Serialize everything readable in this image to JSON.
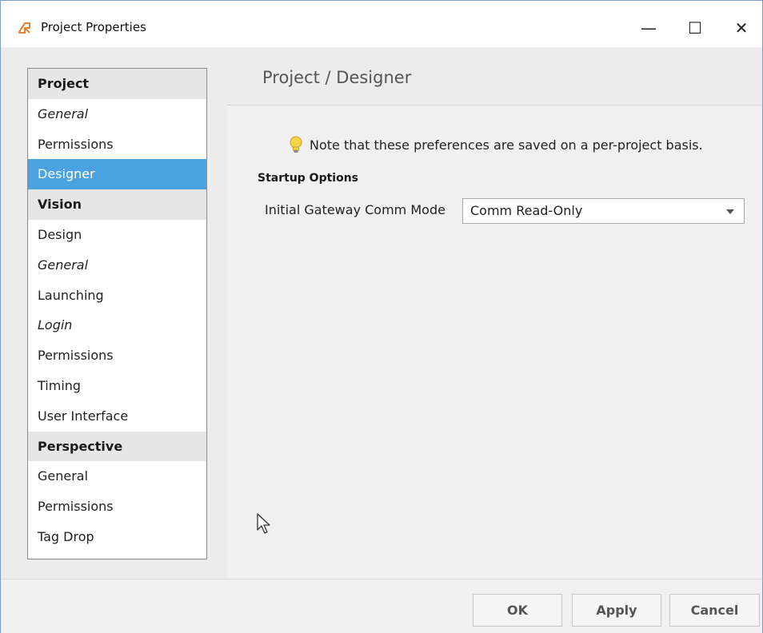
{
  "window": {
    "title": "Project Properties",
    "minimize_glyph": "—",
    "maximize_glyph": "☐",
    "close_glyph": "✕"
  },
  "sidebar": {
    "items": [
      {
        "label": "Project",
        "kind": "header"
      },
      {
        "label": "General",
        "kind": "item",
        "italic": true
      },
      {
        "label": "Permissions",
        "kind": "item"
      },
      {
        "label": "Designer",
        "kind": "item",
        "selected": true
      },
      {
        "label": "Vision",
        "kind": "header"
      },
      {
        "label": "Design",
        "kind": "item"
      },
      {
        "label": "General",
        "kind": "item",
        "italic": true
      },
      {
        "label": "Launching",
        "kind": "item"
      },
      {
        "label": "Login",
        "kind": "item",
        "italic": true
      },
      {
        "label": "Permissions",
        "kind": "item"
      },
      {
        "label": "Timing",
        "kind": "item"
      },
      {
        "label": "User Interface",
        "kind": "item"
      },
      {
        "label": "Perspective",
        "kind": "header"
      },
      {
        "label": "General",
        "kind": "item"
      },
      {
        "label": "Permissions",
        "kind": "item"
      },
      {
        "label": "Tag Drop",
        "kind": "item"
      }
    ]
  },
  "content": {
    "title": "Project / Designer",
    "note": "Note that these preferences are saved on a per-project basis.",
    "note_icon": "lightbulb-icon",
    "section_label": "Startup Options",
    "comm_mode_label": "Initial Gateway Comm Mode",
    "comm_mode_value": "Comm Read-Only"
  },
  "footer": {
    "ok_label": "OK",
    "apply_label": "Apply",
    "cancel_label": "Cancel"
  },
  "colors": {
    "selection": "#4aa3e0",
    "header_bg": "#e6e6e6",
    "app_icon": "#e8731a",
    "bulb": "#f3d34a"
  }
}
